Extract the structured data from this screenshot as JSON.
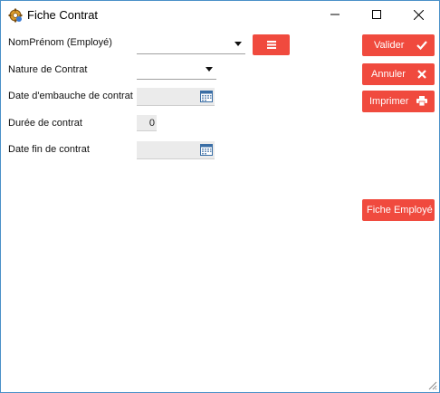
{
  "window": {
    "title": "Fiche Contrat",
    "icons": {
      "app": "app-gear-icon",
      "minimize": "minimize-icon",
      "maximize": "maximize-icon",
      "close": "close-icon"
    }
  },
  "form": {
    "employee_label": "NomPrénom (Employé)",
    "employee_value": "",
    "nature_label": "Nature de Contrat",
    "nature_value": "",
    "hire_date_label": "Date d'embauche de contrat",
    "hire_date_value": "",
    "duration_label": "Durée de contrat",
    "duration_value": "0",
    "end_date_label": "Date fin de contrat",
    "end_date_value": ""
  },
  "buttons": {
    "valider": "Valider",
    "annuler": "Annuler",
    "imprimer": "Imprimer",
    "fiche_employe": "Fiche Employé",
    "list_icon": "list-icon"
  },
  "colors": {
    "accent_red": "#f04a3e",
    "field_bg": "#ebebeb",
    "window_border": "#4a90c8"
  }
}
